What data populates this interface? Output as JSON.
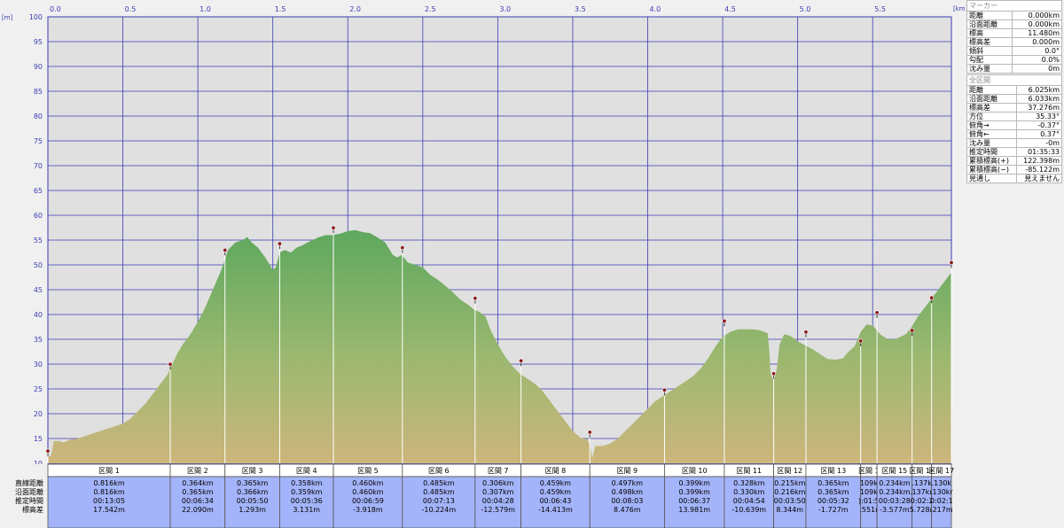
{
  "chart_data": {
    "type": "area",
    "x_unit": "[km]",
    "y_unit": "[m]",
    "xlim": [
      0,
      6.025
    ],
    "ylim": [
      10,
      100
    ],
    "x_ticks": [
      "0.0",
      "0.5",
      "1.0",
      "1.5",
      "2.0",
      "2.5",
      "3.0",
      "3.5",
      "4.0",
      "4.5",
      "5.0",
      "5.5"
    ],
    "y_ticks": [
      "10",
      "15",
      "20",
      "25",
      "30",
      "35",
      "40",
      "45",
      "50",
      "55",
      "60",
      "65",
      "70",
      "75",
      "80",
      "85",
      "90",
      "95",
      "100"
    ],
    "grid": true,
    "colors": {
      "plot_bg": "#e0e0e0",
      "grid": "#3c3cb4",
      "fill_top": "#5ea85e",
      "fill_bottom": "#c8b878",
      "marker": "#8b1a1a",
      "table_bg": "#a4b4fa"
    },
    "profile": [
      [
        0,
        11.4
      ],
      [
        0.02,
        11.5
      ],
      [
        0.04,
        14.5
      ],
      [
        0.08,
        14.5
      ],
      [
        0.1,
        14.2
      ],
      [
        0.15,
        14.8
      ],
      [
        0.2,
        15.0
      ],
      [
        0.3,
        16.0
      ],
      [
        0.4,
        17.0
      ],
      [
        0.5,
        18.0
      ],
      [
        0.55,
        19.0
      ],
      [
        0.6,
        20.5
      ],
      [
        0.65,
        22.0
      ],
      [
        0.7,
        24.0
      ],
      [
        0.75,
        26.0
      ],
      [
        0.8,
        28.0
      ],
      [
        0.816,
        29.2
      ],
      [
        0.83,
        30.0
      ],
      [
        0.86,
        32.0
      ],
      [
        0.9,
        34.0
      ],
      [
        0.95,
        36.0
      ],
      [
        1.0,
        38.5
      ],
      [
        1.05,
        41.5
      ],
      [
        1.1,
        45.0
      ],
      [
        1.15,
        48.5
      ],
      [
        1.18,
        51.0
      ],
      [
        1.2,
        53.0
      ],
      [
        1.25,
        54.5
      ],
      [
        1.3,
        55.0
      ],
      [
        1.33,
        55.6
      ],
      [
        1.36,
        54.5
      ],
      [
        1.4,
        53.5
      ],
      [
        1.45,
        51.5
      ],
      [
        1.5,
        49.0
      ],
      [
        1.52,
        49.5
      ],
      [
        1.545,
        52.5
      ],
      [
        1.58,
        53.0
      ],
      [
        1.62,
        52.5
      ],
      [
        1.66,
        53.5
      ],
      [
        1.7,
        54.0
      ],
      [
        1.75,
        54.8
      ],
      [
        1.8,
        55.5
      ],
      [
        1.85,
        56.0
      ],
      [
        1.9,
        56.0
      ],
      [
        1.95,
        56.3
      ],
      [
        2.0,
        56.8
      ],
      [
        2.05,
        57.0
      ],
      [
        2.1,
        56.6
      ],
      [
        2.15,
        56.4
      ],
      [
        2.2,
        55.5
      ],
      [
        2.25,
        54.5
      ],
      [
        2.3,
        52.0
      ],
      [
        2.33,
        51.5
      ],
      [
        2.36,
        52.0
      ],
      [
        2.4,
        50.5
      ],
      [
        2.45,
        50.0
      ],
      [
        2.5,
        49.5
      ],
      [
        2.55,
        48.0
      ],
      [
        2.6,
        47.0
      ],
      [
        2.65,
        45.8
      ],
      [
        2.7,
        44.5
      ],
      [
        2.75,
        43.0
      ],
      [
        2.8,
        42.0
      ],
      [
        2.84,
        41.0
      ],
      [
        2.88,
        40.5
      ],
      [
        2.92,
        39.5
      ],
      [
        2.95,
        37.0
      ],
      [
        3.0,
        34.0
      ],
      [
        3.05,
        31.5
      ],
      [
        3.1,
        29.5
      ],
      [
        3.15,
        28.0
      ],
      [
        3.2,
        27.0
      ],
      [
        3.25,
        26.0
      ],
      [
        3.3,
        24.5
      ],
      [
        3.35,
        22.5
      ],
      [
        3.4,
        20.5
      ],
      [
        3.45,
        18.5
      ],
      [
        3.5,
        16.5
      ],
      [
        3.55,
        15.2
      ],
      [
        3.6,
        14.8
      ],
      [
        3.62,
        13.0
      ],
      [
        3.63,
        11.0
      ],
      [
        3.65,
        13.5
      ],
      [
        3.7,
        13.5
      ],
      [
        3.75,
        14.0
      ],
      [
        3.8,
        15.0
      ],
      [
        3.85,
        16.5
      ],
      [
        3.9,
        18.0
      ],
      [
        3.95,
        19.5
      ],
      [
        4.0,
        21.0
      ],
      [
        4.05,
        22.5
      ],
      [
        4.1,
        23.5
      ],
      [
        4.15,
        24.5
      ],
      [
        4.2,
        25.5
      ],
      [
        4.3,
        27.5
      ],
      [
        4.35,
        29.0
      ],
      [
        4.4,
        31.0
      ],
      [
        4.45,
        33.5
      ],
      [
        4.5,
        35.5
      ],
      [
        4.55,
        36.5
      ],
      [
        4.6,
        37.0
      ],
      [
        4.65,
        37.0
      ],
      [
        4.7,
        37.0
      ],
      [
        4.75,
        36.8
      ],
      [
        4.8,
        36.2
      ],
      [
        4.81,
        33.0
      ],
      [
        4.82,
        28.0
      ],
      [
        4.84,
        26.5
      ],
      [
        4.86,
        29.0
      ],
      [
        4.88,
        34.0
      ],
      [
        4.91,
        36.0
      ],
      [
        4.94,
        35.8
      ],
      [
        4.97,
        35.3
      ],
      [
        5.0,
        34.6
      ],
      [
        5.05,
        33.8
      ],
      [
        5.1,
        33.0
      ],
      [
        5.15,
        32.0
      ],
      [
        5.2,
        31.0
      ],
      [
        5.25,
        30.9
      ],
      [
        5.3,
        31.1
      ],
      [
        5.34,
        32.5
      ],
      [
        5.38,
        33.6
      ],
      [
        5.42,
        36.5
      ],
      [
        5.46,
        38.0
      ],
      [
        5.5,
        37.8
      ],
      [
        5.55,
        36.0
      ],
      [
        5.6,
        35.0
      ],
      [
        5.65,
        35.0
      ],
      [
        5.72,
        36.0
      ],
      [
        5.76,
        37.5
      ],
      [
        5.8,
        39.5
      ],
      [
        5.85,
        41.5
      ],
      [
        5.9,
        43.5
      ],
      [
        5.95,
        45.5
      ],
      [
        6.0,
        47.5
      ],
      [
        6.025,
        48.5
      ]
    ],
    "markers": [
      [
        0,
        11.4
      ],
      [
        0.816,
        28.9
      ],
      [
        1.181,
        51.9
      ],
      [
        1.546,
        53.2
      ],
      [
        1.904,
        56.4
      ],
      [
        2.364,
        52.4
      ],
      [
        2.849,
        42.2
      ],
      [
        3.155,
        29.6
      ],
      [
        3.614,
        15.2
      ],
      [
        4.112,
        23.7
      ],
      [
        4.511,
        37.6
      ],
      [
        4.84,
        27.0
      ],
      [
        5.055,
        35.4
      ],
      [
        5.42,
        33.6
      ],
      [
        5.529,
        39.3
      ],
      [
        5.763,
        35.7
      ],
      [
        5.893,
        42.3
      ],
      [
        6.025,
        49.4
      ]
    ],
    "table": {
      "row_labels": [
        "直線距離",
        "沿面距離",
        "推定時間",
        "標高差"
      ],
      "segments": [
        {
          "name": "区間 1",
          "straight": "0.816km",
          "surface": "0.816km",
          "time": "00:13:05",
          "elev": "17.542m"
        },
        {
          "name": "区間 2",
          "straight": "0.364km",
          "surface": "0.365km",
          "time": "00:06:34",
          "elev": "22.090m"
        },
        {
          "name": "区間 3",
          "straight": "0.365km",
          "surface": "0.366km",
          "time": "00:05:50",
          "elev": "1.293m"
        },
        {
          "name": "区間 4",
          "straight": "0.358km",
          "surface": "0.359km",
          "time": "00:05:36",
          "elev": "3.131m"
        },
        {
          "name": "区間 5",
          "straight": "0.460km",
          "surface": "0.460km",
          "time": "00:06:59",
          "elev": "-3.918m"
        },
        {
          "name": "区間 6",
          "straight": "0.485km",
          "surface": "0.485km",
          "time": "00:07:13",
          "elev": "-10.224m"
        },
        {
          "name": "区間 7",
          "straight": "0.306km",
          "surface": "0.307km",
          "time": "00:04:28",
          "elev": "-12.579m"
        },
        {
          "name": "区間 8",
          "straight": "0.459km",
          "surface": "0.459km",
          "time": "00:06:43",
          "elev": "-14.413m"
        },
        {
          "name": "区間 9",
          "straight": "0.497km",
          "surface": "0.498km",
          "time": "00:08:03",
          "elev": "8.476m"
        },
        {
          "name": "区間 10",
          "straight": "0.399km",
          "surface": "0.399km",
          "time": "00:06:37",
          "elev": "13.981m"
        },
        {
          "name": "区間 11",
          "straight": "0.328km",
          "surface": "0.330km",
          "time": "00:04:54",
          "elev": "-10.639m"
        },
        {
          "name": "区間 12",
          "straight": "0.215km",
          "surface": "0.216km",
          "time": "00:03:50",
          "elev": "8.344m"
        },
        {
          "name": "区間 13",
          "straight": "0.365km",
          "surface": "0.365km",
          "time": "00:05:32",
          "elev": "-1.727m"
        },
        {
          "name": "区間 1",
          "straight": "109k",
          "surface": "109k",
          "time": "):01:5",
          "elev": ".551r"
        },
        {
          "name": "区間 15",
          "straight": "0.234km",
          "surface": "0.234km",
          "time": "00:03:28",
          "elev": "-3.577m"
        },
        {
          "name": "区間 16",
          "straight": ".137k",
          "surface": ".137kn",
          "time": "0:02:2",
          "elev": "5.728n"
        },
        {
          "name": "区間 17",
          "straight": ".130k",
          "surface": ".130kr",
          "time": "0:02:1",
          "elev": ".217m"
        }
      ]
    }
  },
  "marker_panel": {
    "title": "マーカー",
    "rows": [
      {
        "label": "距離",
        "value": "0.000km"
      },
      {
        "label": "沿面距離",
        "value": "0.000km"
      },
      {
        "label": "標高",
        "value": "11.480m"
      },
      {
        "label": "標高差",
        "value": "0.000m"
      },
      {
        "label": "傾斜",
        "value": "0.0°"
      },
      {
        "label": "勾配",
        "value": "0.0%"
      },
      {
        "label": "沈み量",
        "value": "0m"
      }
    ]
  },
  "section_panel": {
    "title": "全区間",
    "rows": [
      {
        "label": "距離",
        "value": "6.025km"
      },
      {
        "label": "沿面距離",
        "value": "6.033km"
      },
      {
        "label": "標高差",
        "value": "37.276m"
      },
      {
        "label": "方位",
        "value": "35.33°"
      },
      {
        "label": "俯角→",
        "value": "-0.37°"
      },
      {
        "label": "俯角←",
        "value": "0.37°"
      },
      {
        "label": "沈み量",
        "value": "-0m"
      },
      {
        "label": "推定時間",
        "value": "01:35:33"
      },
      {
        "label": "累積標高(+)",
        "value": "122.398m"
      },
      {
        "label": "累積標高(−)",
        "value": "-85.122m"
      },
      {
        "label": "見通し",
        "value": "見えません"
      }
    ]
  }
}
